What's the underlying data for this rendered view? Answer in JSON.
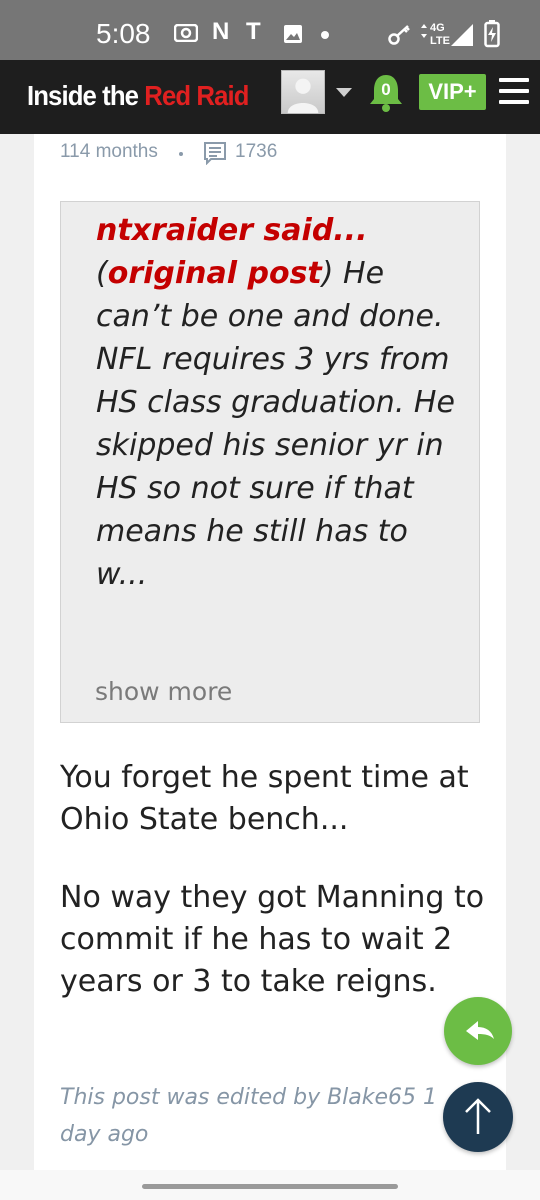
{
  "status_bar": {
    "time": "5:08",
    "icons": [
      "camera-icon",
      "netflix-icon",
      "t-icon",
      "image-icon",
      "dot-icon",
      "key-icon",
      "signal-4g-lte-icon",
      "battery-charging-icon"
    ],
    "network_label_top": "4G",
    "network_label_bottom": "LTE",
    "n_glyph": "N",
    "t_glyph": "T"
  },
  "header": {
    "logo_white": "Inside the ",
    "logo_red": "Red Raiders",
    "notification_count": "0",
    "vip_label": "VIP+",
    "colors": {
      "background": "#1e1e1e",
      "accent_red": "#e02020",
      "vip_green": "#6cbd45"
    }
  },
  "post": {
    "meta_age": "114 months",
    "meta_comment_count": "1736",
    "quote": {
      "author": "ntxraider said...",
      "link_label": "original post",
      "text_part1": "(",
      "text_part2": ") He can’t be one and done. NFL requires 3 yrs from HS class graduation. He skipped his senior yr in HS so not sure if that means he still has to w...",
      "show_more": "show more"
    },
    "paragraphs": [
      "You forget he spent time at Ohio State bench...",
      "No way they got Manning to commit if he has to wait 2 years or 3 to take reigns."
    ],
    "edited_note": "This post was edited by Blake65 1 day ago"
  },
  "fab": {
    "reply_icon": "reply-arrow-icon",
    "top_icon": "arrow-up-icon",
    "colors": {
      "reply": "#6cbd45",
      "top": "#1e3a52"
    }
  }
}
